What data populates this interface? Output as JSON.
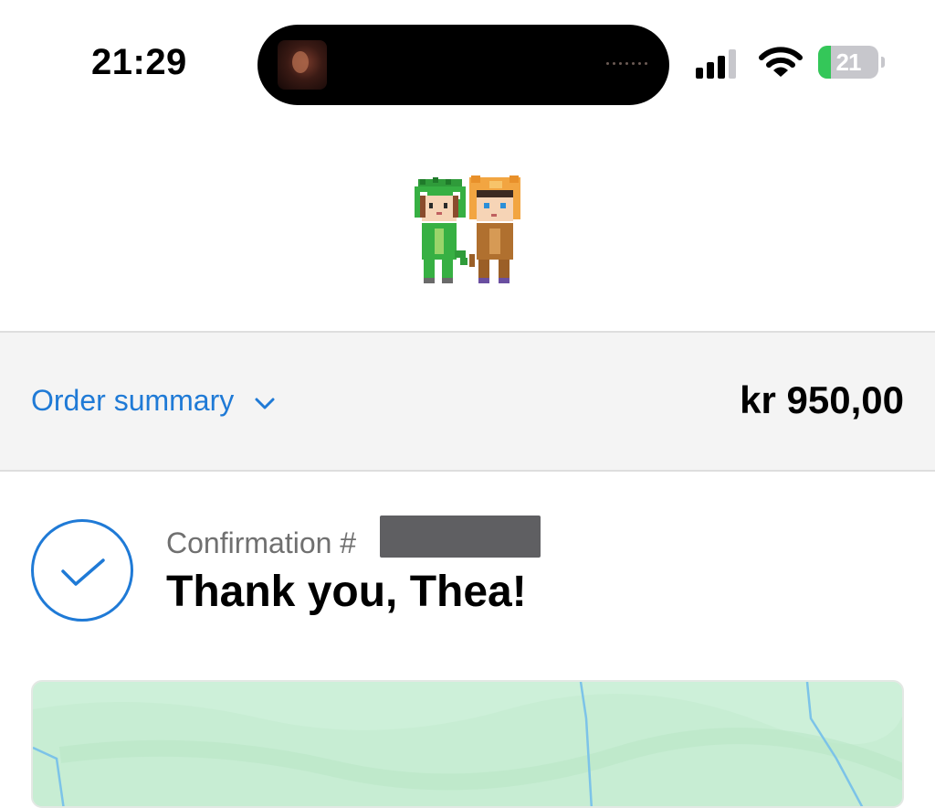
{
  "status_bar": {
    "time": "21:29",
    "battery_level": "21",
    "battery_percent": 21,
    "signal_bars_filled": 3,
    "signal_bars_total": 4,
    "icons": [
      "signal-icon",
      "wifi-icon",
      "battery-icon",
      "now-playing-artwork"
    ]
  },
  "store": {
    "logo_icon": "pixel-art-couple-logo"
  },
  "order_summary": {
    "label": "Order summary",
    "total": "kr 950,00",
    "toggle_icon": "chevron-down-icon"
  },
  "confirmation": {
    "label": "Confirmation #",
    "number_redacted": true,
    "message": "Thank you, Thea!",
    "icon": "checkmark-circle-icon"
  },
  "colors": {
    "accent": "#1f7ad6",
    "summary_background": "#f4f4f4",
    "map_land": "#cdf0d9",
    "map_lines": "#7cc3e8",
    "battery_fill": "#34c759"
  }
}
